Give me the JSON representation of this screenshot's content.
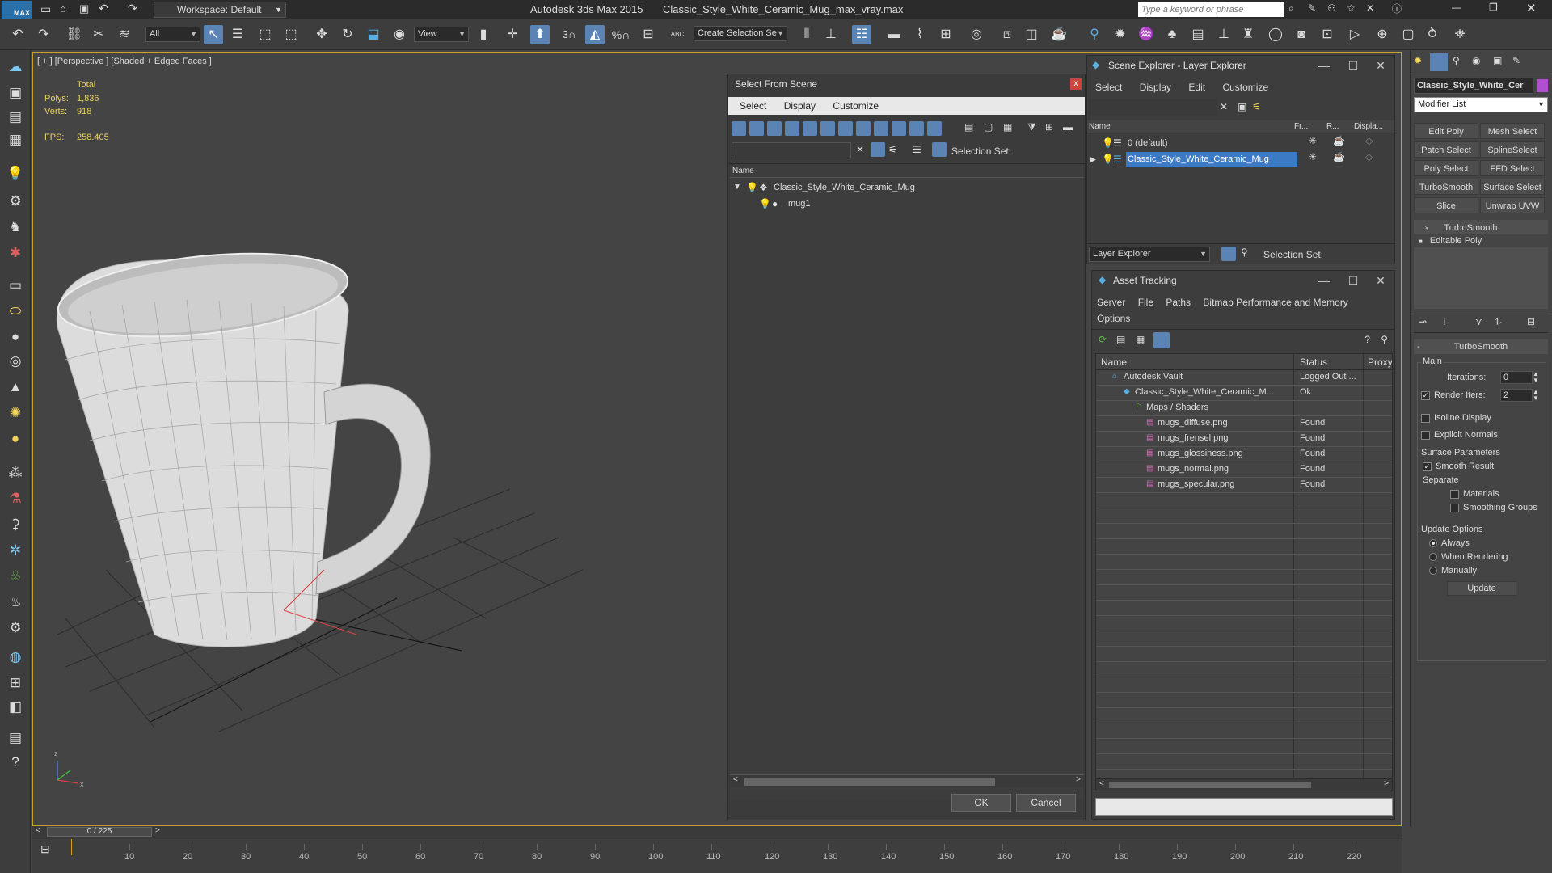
{
  "titlebar": {
    "app_title": "Autodesk 3ds Max  2015",
    "file_title": "Classic_Style_White_Ceramic_Mug_max_vray.max",
    "workspace_label": "Workspace: Default",
    "search_placeholder": "Type a keyword or phrase",
    "max_badge": "MAX"
  },
  "toolbar": {
    "filter_select": "All",
    "ref_coord_select": "View",
    "named_selection": "Create Selection Se",
    "snap_label": "3",
    "percent_snap": "%",
    "abc_label": "ABC"
  },
  "viewport": {
    "label": "[ + ] [Perspective ] [Shaded + Edged Faces ]",
    "stats_total": "Total",
    "polys_label": "Polys:",
    "polys_value": "1,836",
    "verts_label": "Verts:",
    "verts_value": "918",
    "fps_label": "FPS:",
    "fps_value": "258.405",
    "axis_z": "z",
    "axis_x": "x"
  },
  "select_from_scene": {
    "title": "Select From Scene",
    "menu": [
      "Select",
      "Display",
      "Customize"
    ],
    "selection_set_label": "Selection Set:",
    "column_name": "Name",
    "tree": [
      {
        "label": "Classic_Style_White_Ceramic_Mug",
        "level": 0
      },
      {
        "label": "mug1",
        "level": 1
      }
    ],
    "ok_label": "OK",
    "cancel_label": "Cancel"
  },
  "scene_explorer": {
    "title": "Scene Explorer - Layer Explorer",
    "menu": [
      "Select",
      "Display",
      "Edit",
      "Customize"
    ],
    "columns": [
      "Name",
      "Fr...",
      "R...",
      "Displa..."
    ],
    "rows": [
      {
        "label": "0 (default)",
        "selected": false
      },
      {
        "label": "Classic_Style_White_Ceramic_Mug",
        "selected": true
      }
    ],
    "footer_dropdown": "Layer Explorer",
    "selection_set_label": "Selection Set:"
  },
  "asset_tracking": {
    "title": "Asset Tracking",
    "menu": [
      "Server",
      "File",
      "Paths",
      "Bitmap Performance and Memory"
    ],
    "menu_row2": [
      "Options"
    ],
    "columns": [
      "Name",
      "Status",
      "Proxy"
    ],
    "rows": [
      {
        "name": "Autodesk Vault",
        "status": "Logged Out ...",
        "indent": 1,
        "icon": "vault-icon"
      },
      {
        "name": "Classic_Style_White_Ceramic_M...",
        "status": "Ok",
        "indent": 2,
        "icon": "max-file-icon"
      },
      {
        "name": "Maps / Shaders",
        "status": "",
        "indent": 3,
        "icon": "maps-folder-icon"
      },
      {
        "name": "mugs_diffuse.png",
        "status": "Found",
        "indent": 4,
        "icon": "png-icon"
      },
      {
        "name": "mugs_frensel.png",
        "status": "Found",
        "indent": 4,
        "icon": "png-icon"
      },
      {
        "name": "mugs_glossiness.png",
        "status": "Found",
        "indent": 4,
        "icon": "png-icon"
      },
      {
        "name": "mugs_normal.png",
        "status": "Found",
        "indent": 4,
        "icon": "png-icon"
      },
      {
        "name": "mugs_specular.png",
        "status": "Found",
        "indent": 4,
        "icon": "png-icon"
      }
    ]
  },
  "command_panel": {
    "object_name": "Classic_Style_White_Cer",
    "modifier_list": "Modifier List",
    "modifier_buttons": [
      "Edit Poly",
      "Mesh Select",
      "Patch Select",
      "SplineSelect",
      "Poly Select",
      "FFD Select",
      "TurboSmooth",
      "Surface Select",
      "Slice",
      "Unwrap UVW"
    ],
    "stack": [
      "TurboSmooth",
      "Editable Poly"
    ],
    "rollout_title": "TurboSmooth",
    "main_label": "Main",
    "iterations_label": "Iterations:",
    "iterations_value": "0",
    "render_iters_label": "Render Iters:",
    "render_iters_value": "2",
    "isoline_label": "Isoline Display",
    "explicit_normals_label": "Explicit Normals",
    "surface_params_label": "Surface Parameters",
    "smooth_result_label": "Smooth Result",
    "separate_label": "Separate",
    "materials_label": "Materials",
    "smoothing_groups_label": "Smoothing Groups",
    "update_options_label": "Update Options",
    "always_label": "Always",
    "when_rendering_label": "When Rendering",
    "manually_label": "Manually",
    "update_button": "Update"
  },
  "timeline": {
    "frame_counter": "0 / 225",
    "ticks": [
      "10",
      "20",
      "30",
      "40",
      "50",
      "60",
      "70",
      "80",
      "90",
      "100",
      "110",
      "120",
      "130",
      "140",
      "150",
      "160",
      "170",
      "180",
      "190",
      "200",
      "210",
      "220"
    ]
  }
}
